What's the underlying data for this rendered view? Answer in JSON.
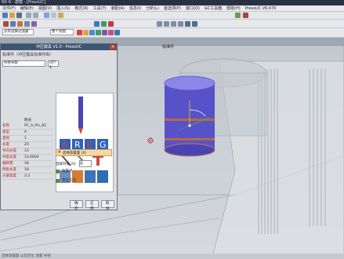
{
  "window": {
    "title": "NX 6 - 建模 - [PressUC]"
  },
  "menu": [
    "文件(F)",
    "编辑(E)",
    "视图(V)",
    "插入(S)",
    "格式(R)",
    "工具(T)",
    "装配(A)",
    "信息(I)",
    "分析(L)",
    "首选项(P)",
    "窗口(O)",
    "GC工具箱",
    "帮助(H)",
    "PressUC V6.670"
  ],
  "toolbar": {
    "filter_value": "整个装配",
    "snap_value": "没有选择过滤器"
  },
  "dialog": {
    "title": "冲压模具 V1.0 - PressUC",
    "subtitle": "标准件（冲压模具标准件库）",
    "category": "导柱导套",
    "size": "SPT 1",
    "table_header": "数值",
    "props": [
      {
        "k": "名称",
        "v": "PC_A_Pin_B1"
      },
      {
        "k": "类型",
        "v": "A"
      },
      {
        "k": "直径",
        "v": "1"
      },
      {
        "k": "长度",
        "v": "20"
      },
      {
        "k": "导向长度",
        "v": "13"
      },
      {
        "k": "导套长度",
        "v": "13.0004"
      },
      {
        "k": "偏移量",
        "v": "18"
      },
      {
        "k": "倒角长度",
        "v": "18"
      },
      {
        "k": "头部高度",
        "v": "3.3"
      }
    ],
    "options": {
      "pos_label": "选择放置面 (0)",
      "obj_label": "选择对象 (0)",
      "face_label": "面",
      "opt1": "放置点",
      "opt2": "定位方向"
    },
    "buttons": {
      "ok": "确定",
      "apply": "应用",
      "cancel": "取消"
    }
  },
  "viewport": {
    "caption": "标准件"
  },
  "status": {
    "text": "选择放置面 以及定位 放置 导柱"
  }
}
